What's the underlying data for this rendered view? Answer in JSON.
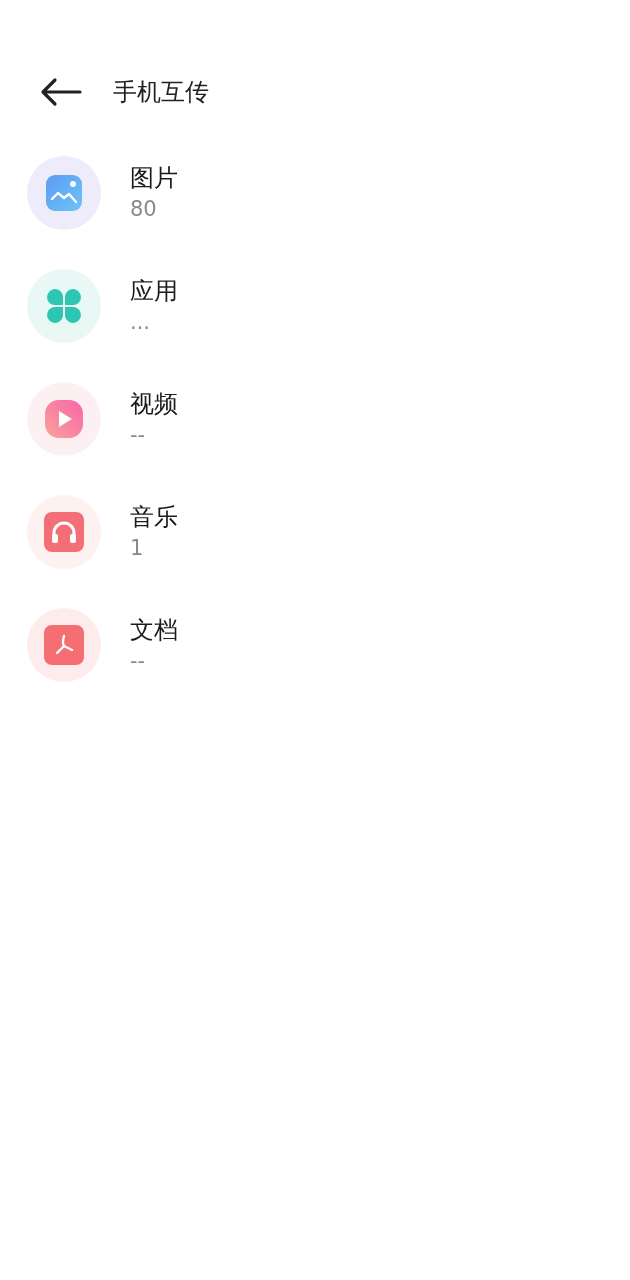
{
  "header": {
    "title": "手机互传"
  },
  "categories": [
    {
      "kind": "image",
      "name": "图片",
      "count": "80"
    },
    {
      "kind": "app",
      "name": "应用",
      "count": "..."
    },
    {
      "kind": "video",
      "name": "视频",
      "count": "--"
    },
    {
      "kind": "music",
      "name": "音乐",
      "count": "1"
    },
    {
      "kind": "document",
      "name": "文档",
      "count": "--"
    }
  ]
}
